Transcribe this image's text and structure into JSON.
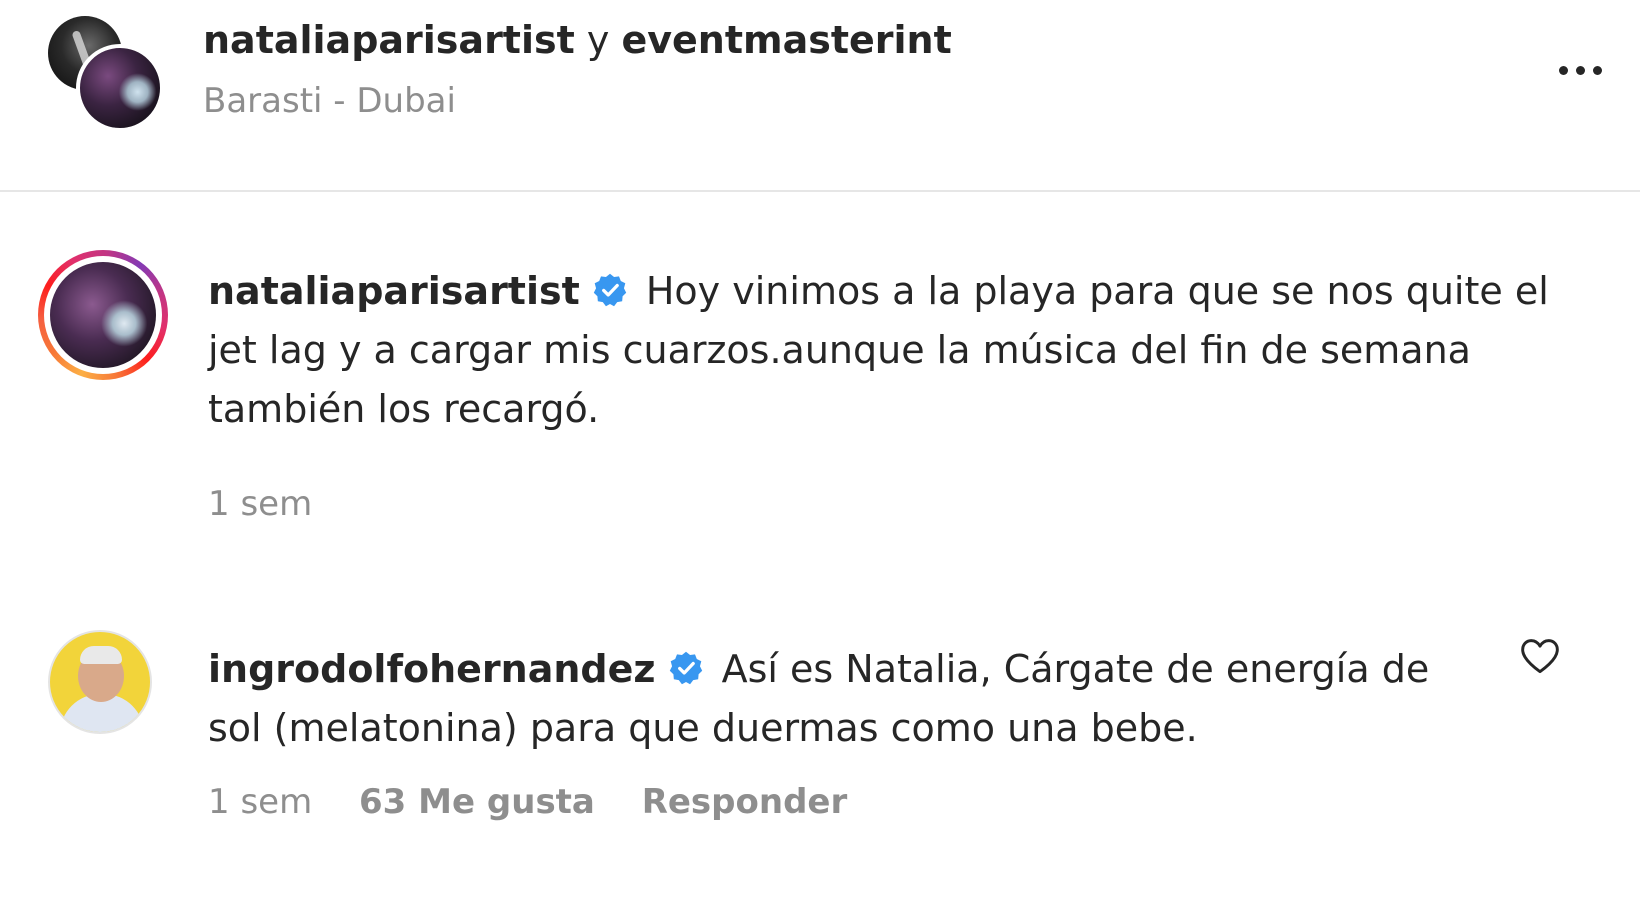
{
  "header": {
    "author_1": "nataliaparisartist",
    "conjunction": "y",
    "author_2": "eventmasterint",
    "location": "Barasti - Dubai"
  },
  "caption": {
    "username": "nataliaparisartist",
    "text": "Hoy vinimos a la playa para que se nos quite el jet lag y a cargar mis cuarzos.aunque la música del fin de semana también los recargó.",
    "time": "1 sem"
  },
  "reply": {
    "username": "ingrodolfohernandez",
    "text": "Así es Natalia, Cárgate de energía de sol (melatonina) para que duermas como una bebe.",
    "time": "1 sem",
    "likes": "63 Me gusta",
    "reply_label": "Responder"
  },
  "colors": {
    "verified_badge": "#3897f0",
    "primary_text": "#262626",
    "secondary_text": "#8e8e8e"
  },
  "icons": {
    "more": "more-options-icon",
    "verified": "verified-badge-icon",
    "like": "heart-outline-icon"
  }
}
